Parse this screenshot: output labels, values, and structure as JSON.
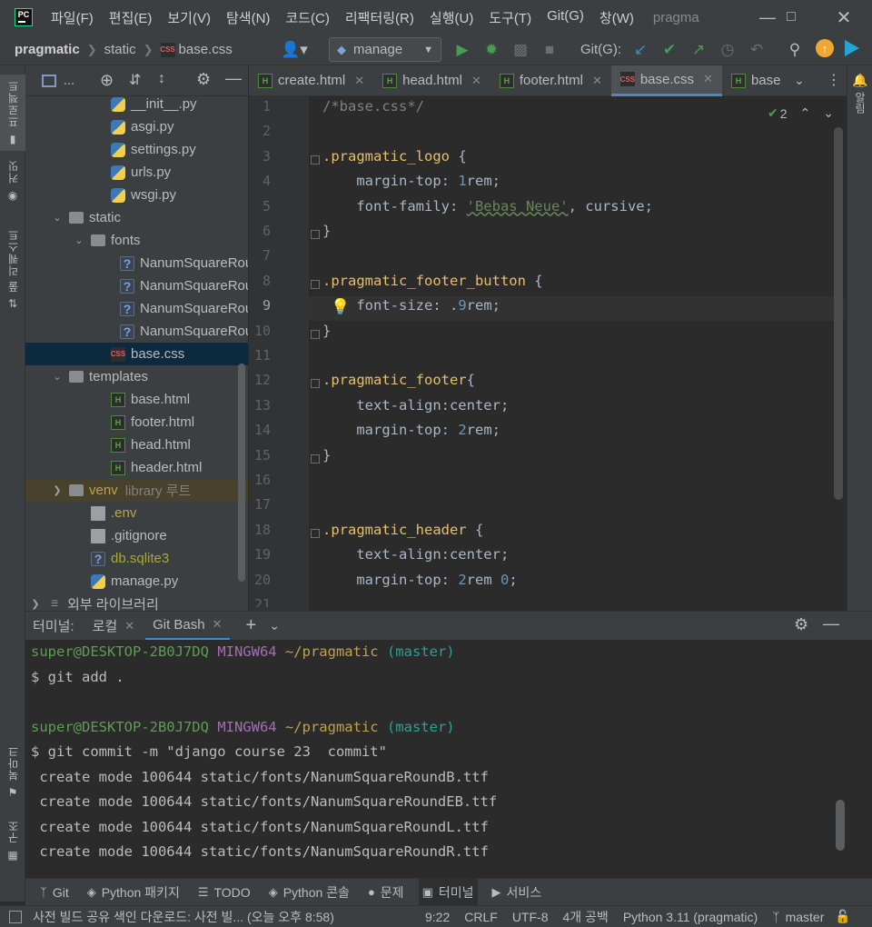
{
  "app": {
    "icon_label": "PC",
    "window_title": "pragma",
    "menu": [
      "파일(F)",
      "편집(E)",
      "보기(V)",
      "탐색(N)",
      "코드(C)",
      "리팩터링(R)",
      "실행(U)",
      "도구(T)",
      "Git(G)",
      "창(W)"
    ]
  },
  "navbar": {
    "breadcrumb": [
      "pragmatic",
      "static",
      "base.css"
    ],
    "run_config": "manage",
    "git_label": "Git(G):"
  },
  "left_strip": {
    "tabs": [
      "프로젝트",
      "커밋",
      "풀 리퀘스트",
      "북마크",
      "구조"
    ]
  },
  "right_strip": {
    "tabs": [
      "알림"
    ]
  },
  "project_panel": {
    "header_label": "...",
    "tree": [
      {
        "label": "__init__.py",
        "icon": "python-file-icon",
        "indent": 3
      },
      {
        "label": "asgi.py",
        "icon": "python-file-icon",
        "indent": 3
      },
      {
        "label": "settings.py",
        "icon": "python-file-icon",
        "indent": 3
      },
      {
        "label": "urls.py",
        "icon": "python-file-icon",
        "indent": 3
      },
      {
        "label": "wsgi.py",
        "icon": "python-file-icon",
        "indent": 3
      },
      {
        "label": "static",
        "icon": "folder-icon",
        "indent": 1,
        "expanded": true
      },
      {
        "label": "fonts",
        "icon": "folder-icon",
        "indent": 2,
        "expanded": true
      },
      {
        "label": "NanumSquareRou",
        "icon": "unknown-file-icon",
        "indent": 4
      },
      {
        "label": "NanumSquareRou",
        "icon": "unknown-file-icon",
        "indent": 4
      },
      {
        "label": "NanumSquareRou",
        "icon": "unknown-file-icon",
        "indent": 4
      },
      {
        "label": "NanumSquareRou",
        "icon": "unknown-file-icon",
        "indent": 4
      },
      {
        "label": "base.css",
        "icon": "css-file-icon",
        "indent": 3,
        "selected": true
      },
      {
        "label": "templates",
        "icon": "folder-icon",
        "indent": 1,
        "expanded": true
      },
      {
        "label": "base.html",
        "icon": "html-file-icon",
        "indent": 3
      },
      {
        "label": "footer.html",
        "icon": "html-file-icon",
        "indent": 3
      },
      {
        "label": "head.html",
        "icon": "html-file-icon",
        "indent": 3
      },
      {
        "label": "header.html",
        "icon": "html-file-icon",
        "indent": 3
      },
      {
        "label": "venv",
        "suffix": "library 루트",
        "icon": "folder-icon",
        "indent": 1,
        "collapsed": true,
        "excluded": true
      },
      {
        "label": ".env",
        "icon": "text-file-icon",
        "indent": 2,
        "color": "#c0a14c"
      },
      {
        "label": ".gitignore",
        "icon": "gitignore-file-icon",
        "indent": 2
      },
      {
        "label": "db.sqlite3",
        "icon": "unknown-file-icon",
        "indent": 2,
        "color": "#a8a83c"
      },
      {
        "label": "manage.py",
        "icon": "python-file-icon",
        "indent": 2
      },
      {
        "label": "외부 라이브러리",
        "icon": "library-icon",
        "indent": 0,
        "collapsed": true
      }
    ]
  },
  "editor": {
    "tabs": [
      {
        "label": "create.html",
        "icon": "html-file-icon"
      },
      {
        "label": "head.html",
        "icon": "html-file-icon"
      },
      {
        "label": "footer.html",
        "icon": "html-file-icon"
      },
      {
        "label": "base.css",
        "icon": "css-file-icon",
        "active": true
      },
      {
        "label": "base",
        "icon": "html-file-icon"
      }
    ],
    "problems_count": "2",
    "lines": [
      {
        "n": "1",
        "parts": [
          [
            "c-comment",
            "/*base.css*/"
          ]
        ]
      },
      {
        "n": "2",
        "parts": []
      },
      {
        "n": "3",
        "parts": [
          [
            "c-sel",
            ".pragmatic_logo"
          ],
          [
            "c-prop",
            " {"
          ]
        ]
      },
      {
        "n": "4",
        "parts": [
          [
            "c-prop",
            "    margin-top: "
          ],
          [
            "c-num",
            "1"
          ],
          [
            "c-prop",
            "rem;"
          ]
        ]
      },
      {
        "n": "5",
        "parts": [
          [
            "c-prop",
            "    font-family: "
          ],
          [
            "c-str",
            "'Bebas Neue'"
          ],
          [
            "c-prop",
            ", cursive;"
          ]
        ]
      },
      {
        "n": "6",
        "parts": [
          [
            "c-prop",
            "}"
          ]
        ]
      },
      {
        "n": "7",
        "parts": []
      },
      {
        "n": "8",
        "parts": [
          [
            "c-sel",
            ".pragmatic_footer_button"
          ],
          [
            "c-prop",
            " {"
          ]
        ]
      },
      {
        "n": "9",
        "parts": [
          [
            "c-prop",
            "    font-size: ."
          ],
          [
            "c-num",
            "9"
          ],
          [
            "c-prop",
            "rem;"
          ]
        ]
      },
      {
        "n": "10",
        "parts": [
          [
            "c-prop",
            "}"
          ]
        ]
      },
      {
        "n": "11",
        "parts": []
      },
      {
        "n": "12",
        "parts": [
          [
            "c-sel",
            ".pragmatic_footer"
          ],
          [
            "c-prop",
            "{"
          ]
        ]
      },
      {
        "n": "13",
        "parts": [
          [
            "c-prop",
            "    text-align:center;"
          ]
        ]
      },
      {
        "n": "14",
        "parts": [
          [
            "c-prop",
            "    margin-top: "
          ],
          [
            "c-num",
            "2"
          ],
          [
            "c-prop",
            "rem;"
          ]
        ]
      },
      {
        "n": "15",
        "parts": [
          [
            "c-prop",
            "}"
          ]
        ]
      },
      {
        "n": "16",
        "parts": []
      },
      {
        "n": "17",
        "parts": []
      },
      {
        "n": "18",
        "parts": [
          [
            "c-sel",
            ".pragmatic_header"
          ],
          [
            "c-prop",
            " {"
          ]
        ]
      },
      {
        "n": "19",
        "parts": [
          [
            "c-prop",
            "    text-align:center;"
          ]
        ]
      },
      {
        "n": "20",
        "parts": [
          [
            "c-prop",
            "    margin-top: "
          ],
          [
            "c-num",
            "2"
          ],
          [
            "c-prop",
            "rem "
          ],
          [
            "c-num",
            "0"
          ],
          [
            "c-prop",
            ";"
          ]
        ]
      }
    ],
    "partial_line_number": "21"
  },
  "terminal": {
    "title": "터미널:",
    "tabs": [
      "로컬",
      "Git Bash"
    ],
    "active_tab": "Git Bash",
    "lines": [
      [
        [
          "t-green",
          "super@DESKTOP-2B0J7DQ "
        ],
        [
          "t-purple",
          "MINGW64 "
        ],
        [
          "t-yellow",
          "~/pragmatic "
        ],
        [
          "t-cyan",
          "(master)"
        ]
      ],
      [
        [
          "",
          "$ git add ."
        ]
      ],
      [],
      [
        [
          "t-green",
          "super@DESKTOP-2B0J7DQ "
        ],
        [
          "t-purple",
          "MINGW64 "
        ],
        [
          "t-yellow",
          "~/pragmatic "
        ],
        [
          "t-cyan",
          "(master)"
        ]
      ],
      [
        [
          "",
          "$ git commit -m \"django course 23  commit\""
        ]
      ],
      [
        [
          "",
          " create mode 100644 static/fonts/NanumSquareRoundB.ttf"
        ]
      ],
      [
        [
          "",
          " create mode 100644 static/fonts/NanumSquareRoundEB.ttf"
        ]
      ],
      [
        [
          "",
          " create mode 100644 static/fonts/NanumSquareRoundL.ttf"
        ]
      ],
      [
        [
          "",
          " create mode 100644 static/fonts/NanumSquareRoundR.ttf"
        ]
      ]
    ]
  },
  "tool_windows": [
    {
      "label": "Git",
      "icon": "git-branch-icon"
    },
    {
      "label": "Python 패키지",
      "icon": "python-packages-icon"
    },
    {
      "label": "TODO",
      "icon": "todo-list-icon"
    },
    {
      "label": "Python 콘솔",
      "icon": "python-console-icon"
    },
    {
      "label": "문제",
      "icon": "problems-icon"
    },
    {
      "label": "터미널",
      "icon": "terminal-icon",
      "active": true
    },
    {
      "label": "서비스",
      "icon": "services-icon"
    }
  ],
  "status": {
    "message": "사전 빌드 공유 색인 다운로드: 사전 빌... (오늘 오후 8:58)",
    "position": "9:22",
    "line_sep": "CRLF",
    "encoding": "UTF-8",
    "indent": "4개 공백",
    "interpreter": "Python 3.11 (pragmatic)",
    "branch": "master"
  },
  "colors": {
    "accent": "#4a88c7",
    "run_green": "#499c54",
    "vcs_update": "#3592c4",
    "update_orange": "#f0a732"
  }
}
